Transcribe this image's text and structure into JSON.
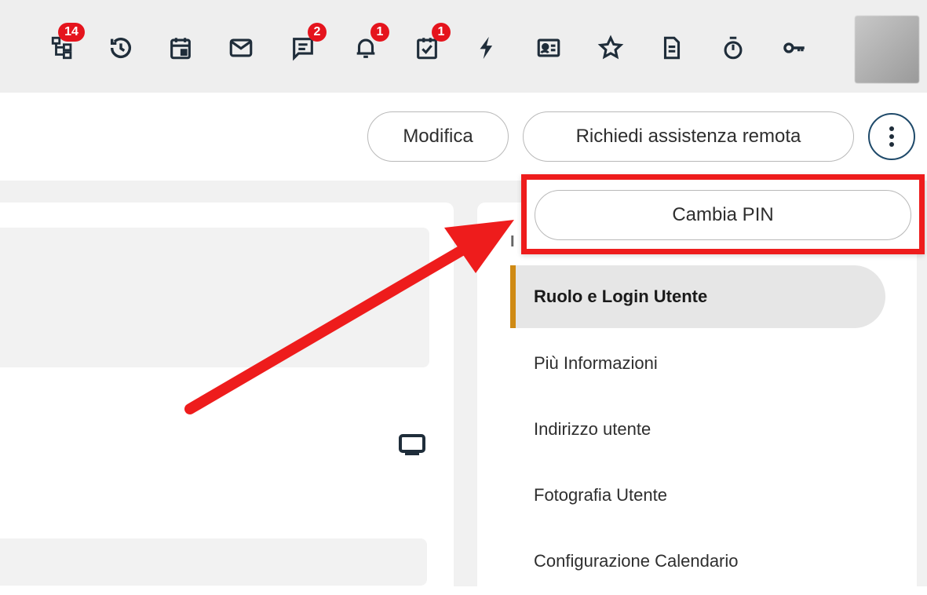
{
  "topbar": {
    "icons": [
      {
        "name": "org-chart-icon",
        "badge": "14"
      },
      {
        "name": "history-icon",
        "badge": ""
      },
      {
        "name": "calendar-icon",
        "badge": ""
      },
      {
        "name": "mail-icon",
        "badge": ""
      },
      {
        "name": "chat-icon",
        "badge": "2"
      },
      {
        "name": "bell-icon",
        "badge": "1"
      },
      {
        "name": "task-check-icon",
        "badge": "1"
      },
      {
        "name": "lightning-icon",
        "badge": ""
      },
      {
        "name": "contact-card-icon",
        "badge": ""
      },
      {
        "name": "star-icon",
        "badge": ""
      },
      {
        "name": "document-icon",
        "badge": ""
      },
      {
        "name": "stopwatch-icon",
        "badge": ""
      },
      {
        "name": "key-icon",
        "badge": ""
      }
    ],
    "icon_color": "#1f2d3a",
    "badge_color": "#e5141d"
  },
  "toolbar": {
    "edit_label": "Modifica",
    "remote_assist_label": "Richiedi assistenza remota"
  },
  "dropdown": {
    "change_pin_label": "Cambia PIN",
    "highlight_color": "#ee1c1c"
  },
  "right_panel": {
    "partial_heading": "I",
    "items": [
      {
        "label": "Ruolo e Login Utente",
        "active": true
      },
      {
        "label": "Più Informazioni",
        "active": false
      },
      {
        "label": "Indirizzo utente",
        "active": false
      },
      {
        "label": "Fotografia Utente",
        "active": false
      },
      {
        "label": "Configurazione Calendario",
        "active": false
      }
    ],
    "active_accent": "#cf8a14"
  }
}
